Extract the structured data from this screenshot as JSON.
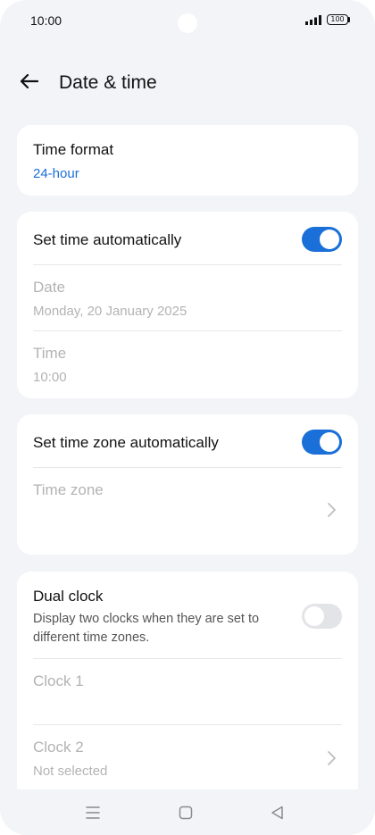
{
  "status_bar": {
    "time": "10:00",
    "battery": "100"
  },
  "header": {
    "title": "Date & time"
  },
  "time_format": {
    "label": "Time format",
    "value": "24-hour"
  },
  "auto_time": {
    "label": "Set time automatically",
    "enabled": true,
    "date_label": "Date",
    "date_value": "Monday, 20 January 2025",
    "time_label": "Time",
    "time_value": "10:00"
  },
  "auto_zone": {
    "label": "Set time zone automatically",
    "enabled": true,
    "zone_label": "Time zone"
  },
  "dual_clock": {
    "label": "Dual clock",
    "description": "Display two clocks when they are set to different time zones.",
    "enabled": false,
    "clock1_label": "Clock 1",
    "clock2_label": "Clock 2",
    "clock2_value": "Not selected"
  },
  "colors": {
    "accent": "#1a6fd8",
    "background": "#f3f4f8",
    "card": "#ffffff"
  },
  "icons": [
    "back-arrow-icon",
    "chevron-right-icon",
    "menu-icon",
    "home-icon",
    "back-icon",
    "signal-icon",
    "battery-icon"
  ]
}
